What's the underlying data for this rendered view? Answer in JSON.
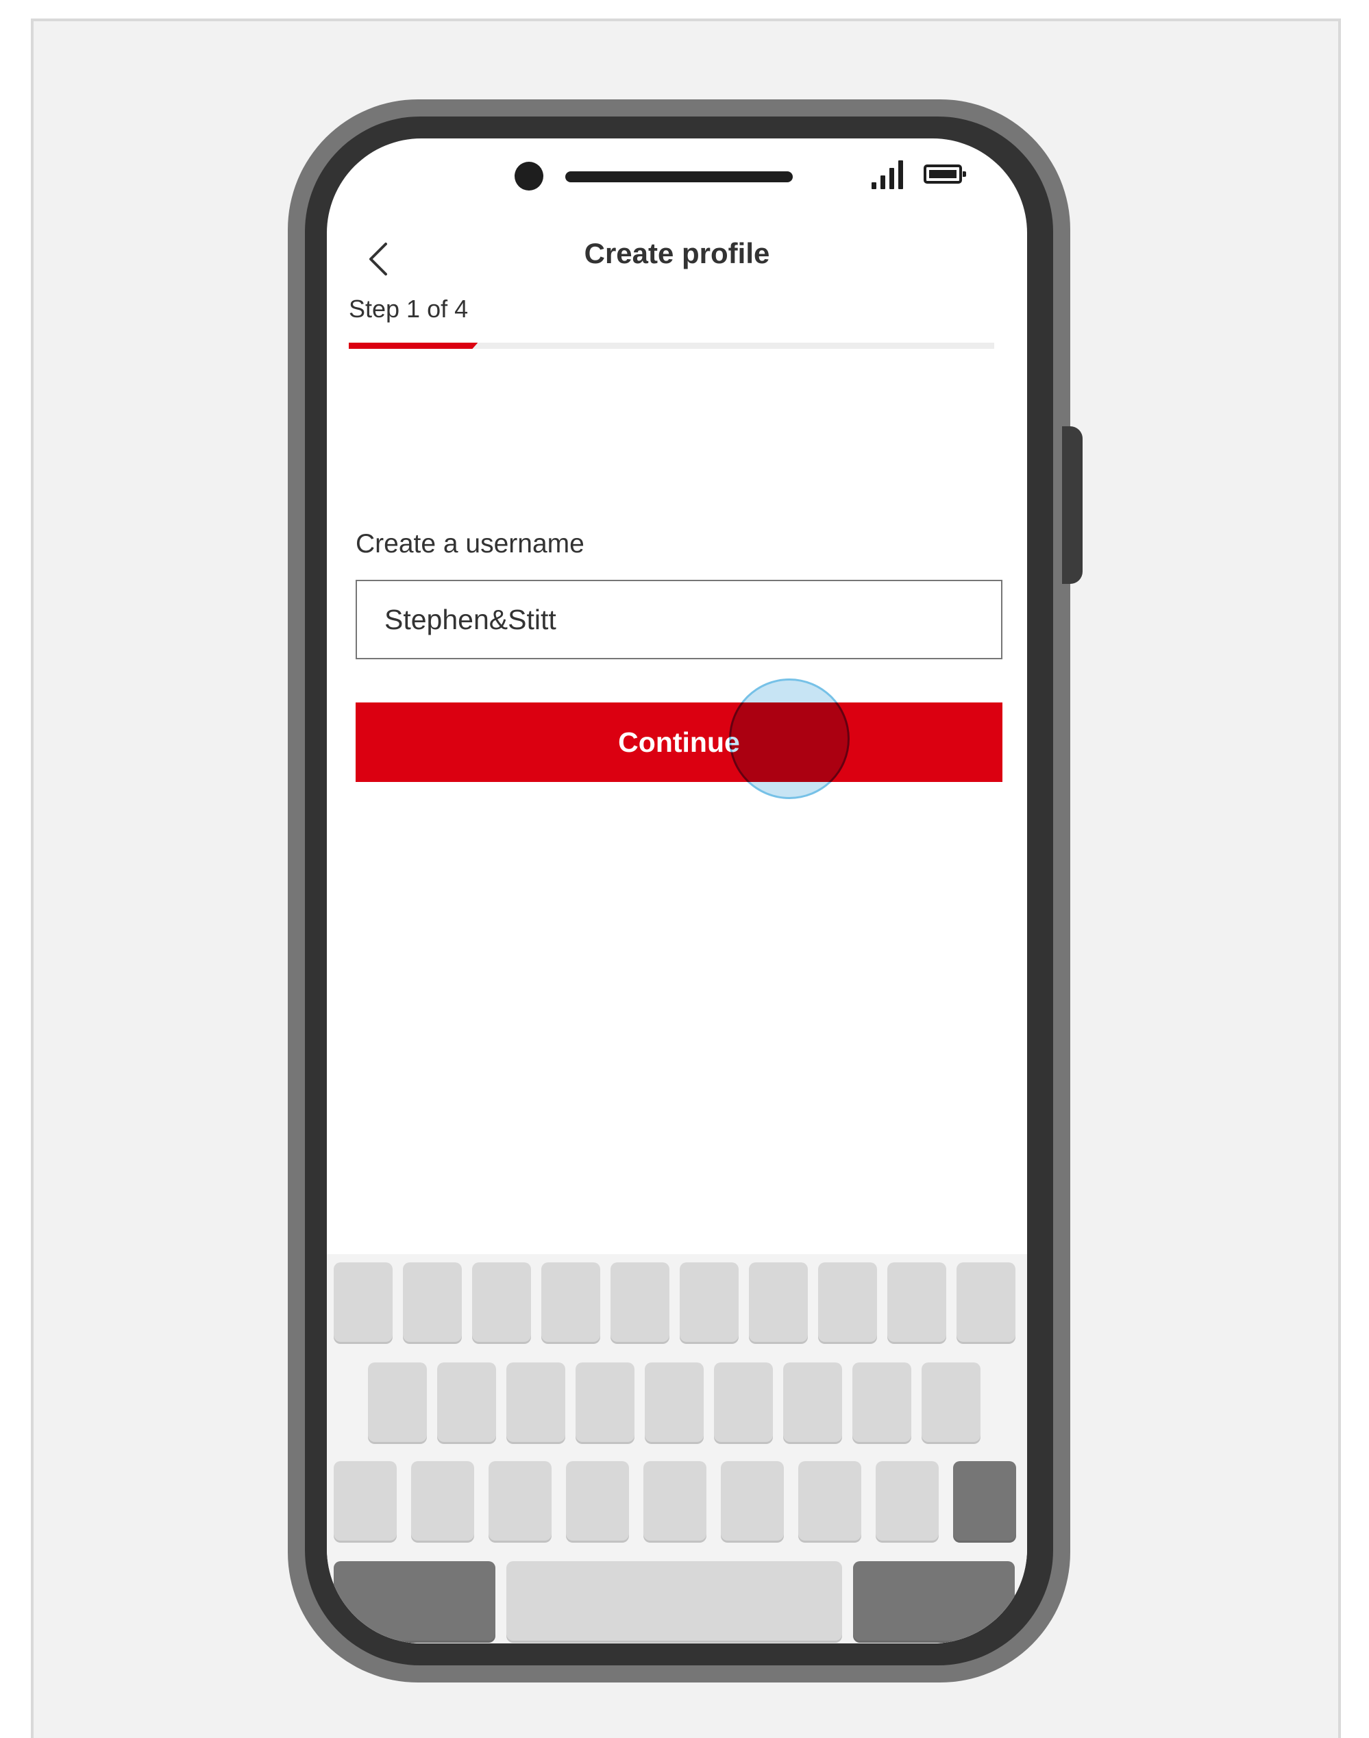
{
  "header": {
    "title": "Create profile",
    "step_text": "Step 1 of 4"
  },
  "progress": {
    "current_step": 1,
    "total_steps": 4,
    "fraction": 0.2
  },
  "form": {
    "username_label": "Create a username",
    "username_value": "Stephen&Stitt",
    "continue_label": "Continue"
  },
  "icons": {
    "back": "chevron-left-icon",
    "signal": "signal-bars-icon",
    "battery": "battery-full-icon"
  },
  "colors": {
    "accent": "#db0011",
    "text": "#333333",
    "frame": "#f2f2f2",
    "device_body": "#767676",
    "device_bezel": "#333333",
    "key": "#d8d8d8",
    "key_dark": "#767676",
    "tap_indicator": "#82c3e6"
  }
}
